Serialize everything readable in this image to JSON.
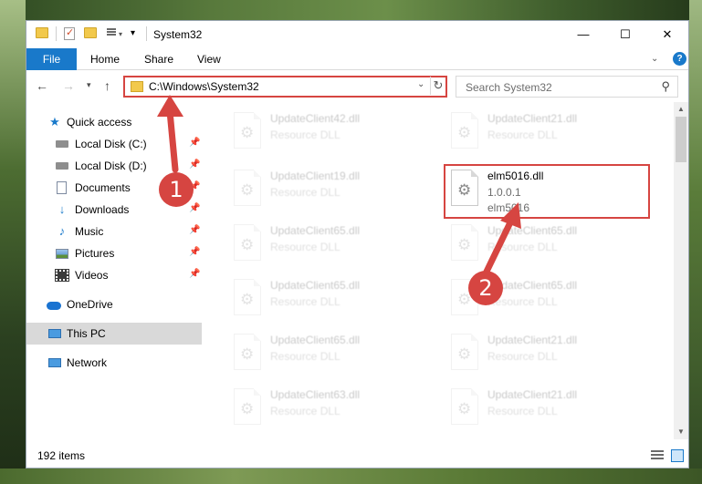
{
  "window": {
    "title": "System32",
    "controls": {
      "minimize": "—",
      "maximize": "☐",
      "close": "✕"
    }
  },
  "ribbon": {
    "tabs": [
      "File",
      "Home",
      "Share",
      "View"
    ],
    "help": "?"
  },
  "address": {
    "path": "C:\\Windows\\System32"
  },
  "search": {
    "placeholder": "Search System32"
  },
  "sidebar": {
    "items": [
      {
        "label": "Quick access",
        "icon": "star-icon"
      },
      {
        "label": "Local Disk (C:)",
        "icon": "drive-icon",
        "pinned": true
      },
      {
        "label": "Local Disk (D:)",
        "icon": "drive-icon",
        "pinned": true
      },
      {
        "label": "Documents",
        "icon": "documents-icon",
        "pinned": true
      },
      {
        "label": "Downloads",
        "icon": "downloads-icon",
        "pinned": true
      },
      {
        "label": "Music",
        "icon": "music-icon",
        "pinned": true
      },
      {
        "label": "Pictures",
        "icon": "pictures-icon",
        "pinned": true
      },
      {
        "label": "Videos",
        "icon": "videos-icon",
        "pinned": true
      },
      {
        "label": "OneDrive",
        "icon": "onedrive-icon"
      },
      {
        "label": "This PC",
        "icon": "this-pc-icon",
        "selected": true
      },
      {
        "label": "Network",
        "icon": "network-icon"
      }
    ]
  },
  "files": [
    {
      "name": "UpdateClient42.dll",
      "desc": "Resource DLL"
    },
    {
      "name": "UpdateClient21.dll",
      "desc": "Resource DLL"
    },
    {
      "name": "UpdateClient19.dll",
      "desc": "Resource DLL"
    },
    {
      "name": "elm5016.dll",
      "desc": "1.0.0.1",
      "extra": "elm5016"
    },
    {
      "name": "UpdateClient65.dll",
      "desc": "Resource DLL"
    },
    {
      "name": "UpdateClient65.dll",
      "desc": "Resource DLL"
    },
    {
      "name": "UpdateClient65.dll",
      "desc": "Resource DLL"
    },
    {
      "name": "UpdateClient65.dll",
      "desc": "Resource DLL"
    },
    {
      "name": "UpdateClient65.dll",
      "desc": "Resource DLL"
    },
    {
      "name": "UpdateClient21.dll",
      "desc": "Resource DLL"
    },
    {
      "name": "UpdateClient63.dll",
      "desc": "Resource DLL"
    },
    {
      "name": "UpdateClient21.dll",
      "desc": "Resource DLL"
    }
  ],
  "status": {
    "item_count": "192 items"
  },
  "callouts": [
    "1",
    "2"
  ],
  "colors": {
    "accent": "#1979ca",
    "annotation": "#d64541"
  }
}
